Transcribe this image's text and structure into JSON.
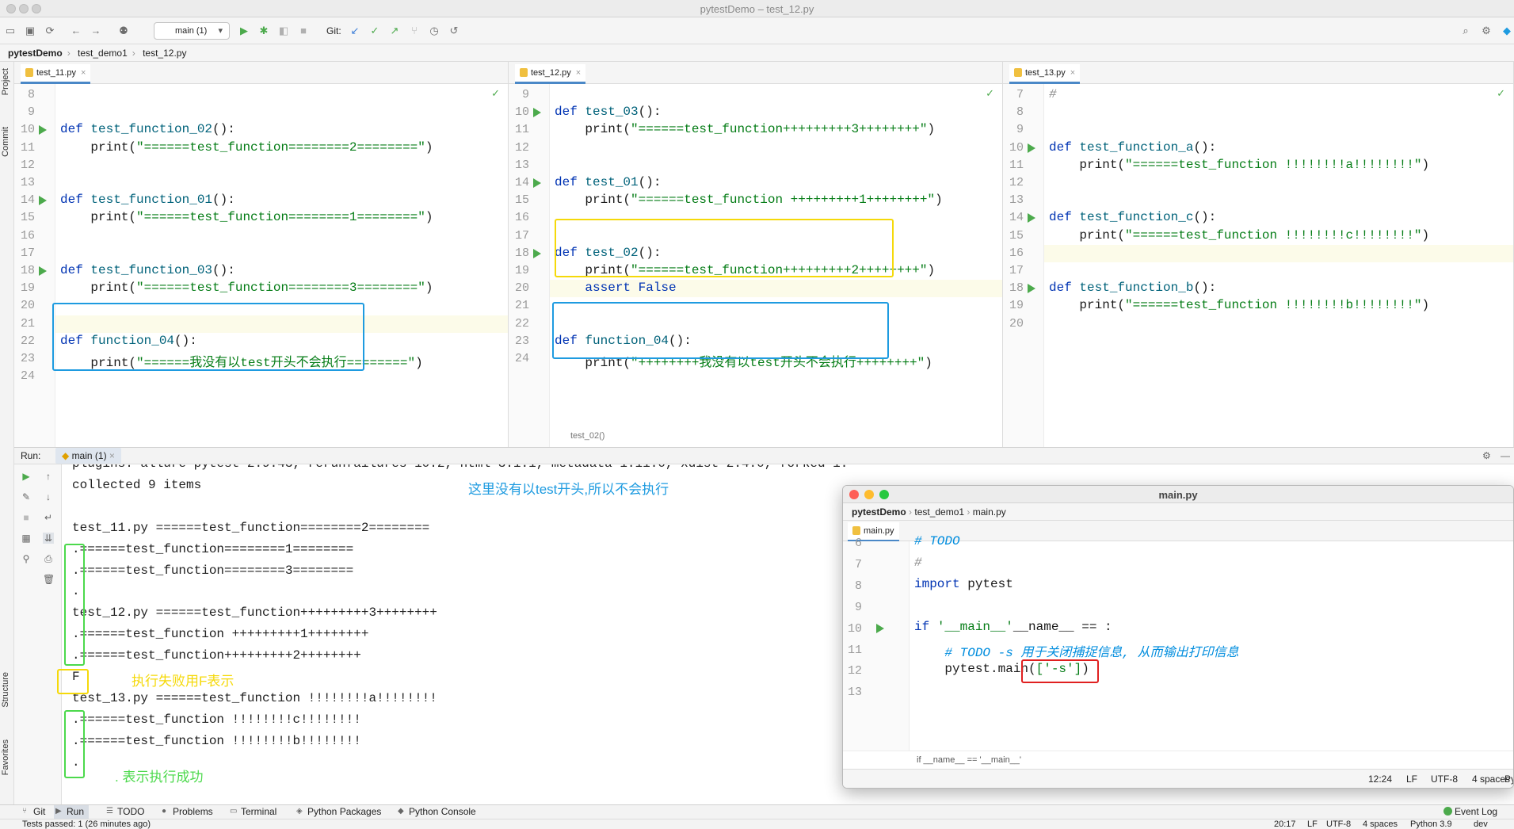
{
  "window": {
    "title": "pytestDemo – test_12.py"
  },
  "toolbar": {
    "run_config": "main (1)",
    "git_label": "Git:"
  },
  "nav": {
    "project": "pytestDemo",
    "folder": "test_demo1",
    "file": "test_12.py"
  },
  "left_strip": {
    "project": "Project",
    "commit": "Commit",
    "structure": "Structure",
    "favorites": "Favorites"
  },
  "editors": [
    {
      "tab": "test_11.py",
      "lines": [
        "8",
        "9",
        "10",
        "11",
        "12",
        "13",
        "14",
        "15",
        "16",
        "17",
        "18",
        "19",
        "20",
        "21",
        "22",
        "23",
        "24"
      ],
      "code": [
        {
          "k": "def ",
          "f": "test_function_02",
          "r": "():"
        },
        {
          "p": "    print(",
          "s": "\"======test_function========2========\"",
          "r": ")"
        },
        {
          "k": "def ",
          "f": "test_function_01",
          "r": "():"
        },
        {
          "p": "    print(",
          "s": "\"======test_function========1========\"",
          "r": ")"
        },
        {
          "k": "def ",
          "f": "test_function_03",
          "r": "():"
        },
        {
          "p": "    print(",
          "s": "\"======test_function========3========\"",
          "r": ")"
        },
        {
          "k": "def ",
          "f": "function_04",
          "r": "():"
        },
        {
          "p": "    print(",
          "s": "\"======我没有以test开头不会执行========\"",
          "r": ")"
        }
      ]
    },
    {
      "tab": "test_12.py",
      "lines": [
        "9",
        "10",
        "11",
        "12",
        "13",
        "14",
        "15",
        "16",
        "17",
        "18",
        "19",
        "20",
        "21",
        "22",
        "23",
        "24"
      ],
      "code": [
        {
          "k": "def ",
          "f": "test_03",
          "r": "():"
        },
        {
          "p": "    print(",
          "s": "\"======test_function+++++++++3++++++++\"",
          "r": ")"
        },
        {
          "k": "def ",
          "f": "test_01",
          "r": "():"
        },
        {
          "p": "    print(",
          "s": "\"======test_function +++++++++1++++++++\"",
          "r": ")"
        },
        {
          "k": "def ",
          "f": "test_02",
          "r": "():"
        },
        {
          "p": "    print(",
          "s": "\"======test_function+++++++++2++++++++\"",
          "r": ")"
        },
        {
          "p": "    ",
          "k": "assert False"
        },
        {
          "k": "def ",
          "f": "function_04",
          "r": "():"
        },
        {
          "p": "    print(",
          "s": "\"++++++++我没有以test开头不会执行++++++++\"",
          "r": ")"
        }
      ],
      "crumb": "test_02()"
    },
    {
      "tab": "test_13.py",
      "lines": [
        "7",
        "8",
        "9",
        "10",
        "11",
        "12",
        "13",
        "14",
        "15",
        "16",
        "17",
        "18",
        "19",
        "20"
      ],
      "code": [
        {
          "c": "#"
        },
        {
          "k": "def ",
          "f": "test_function_a",
          "r": "():"
        },
        {
          "p": "    print(",
          "s": "\"======test_function !!!!!!!!a!!!!!!!!\"",
          "r": ")"
        },
        {
          "k": "def ",
          "f": "test_function_c",
          "r": "():"
        },
        {
          "p": "    print(",
          "s": "\"======test_function !!!!!!!!c!!!!!!!!\"",
          "r": ")"
        },
        {
          "k": "def ",
          "f": "test_function_b",
          "r": "():"
        },
        {
          "p": "    print(",
          "s": "\"======test_function !!!!!!!!b!!!!!!!!\"",
          "r": ")"
        }
      ]
    }
  ],
  "run": {
    "label": "Run:",
    "tab": "main (1)"
  },
  "console": [
    "plugins: allure-pytest-2.9.43, rerunfailures-10.2, html-3.1.1, metadata-1.11.0, xdist-2.4.0, forked-1.3.0",
    "collected 9 items",
    "",
    "test_11.py ======test_function========2========",
    ".======test_function========1========",
    ".======test_function========3========",
    ".",
    "test_12.py ======test_function+++++++++3++++++++",
    ".======test_function +++++++++1++++++++",
    ".======test_function+++++++++2++++++++",
    "F",
    "test_13.py ======test_function !!!!!!!!a!!!!!!!!",
    ".======test_function !!!!!!!!c!!!!!!!!",
    ".======test_function !!!!!!!!b!!!!!!!!",
    "."
  ],
  "annotations": {
    "no_test": "这里没有以test开头,所以不会执行",
    "fail": "执行失败用F表示",
    "success": ". 表示执行成功"
  },
  "main_window": {
    "title": "main.py",
    "nav": {
      "project": "pytestDemo",
      "folder": "test_demo1",
      "file": "main.py"
    },
    "tab": "main.py",
    "lines": [
      "6",
      "7",
      "8",
      "9",
      "10",
      "11",
      "12",
      "13"
    ],
    "code": [
      {
        "c": "# TODO"
      },
      {
        "c": "#"
      },
      {
        "k": "import ",
        "r": "pytest"
      },
      {
        "r": ""
      },
      {
        "k": "if ",
        "r": "__name__ == ",
        "s": "'__main__'",
        "r2": ":"
      },
      {
        "p": "    ",
        "c": "# TODO -s 用于关闭捕捉信息, 从而输出打印信息"
      },
      {
        "p": "    pytest.main(",
        "s": "['-s']",
        "r": ")"
      }
    ],
    "crumb": "if __name__ == '__main__'",
    "status": {
      "pos": "12:24",
      "lf": "LF",
      "enc": "UTF-8",
      "indent": "4 spaces",
      "py": "Py"
    }
  },
  "bottom_tabs": [
    "Git",
    "Run",
    "TODO",
    "Problems",
    "Terminal",
    "Python Packages",
    "Python Console"
  ],
  "event_log": "Event Log",
  "status": {
    "msg": "Tests passed: 1 (26 minutes ago)",
    "pos": "20:17",
    "lf": "LF",
    "enc": "UTF-8",
    "indent": "4 spaces",
    "py": "Python 3.9",
    "branch": "dev"
  },
  "colors": {
    "yellow_box": "#f5d90a",
    "blue_box": "#1e9be0",
    "green_box": "#4cd94c",
    "red_box": "#e02020"
  }
}
